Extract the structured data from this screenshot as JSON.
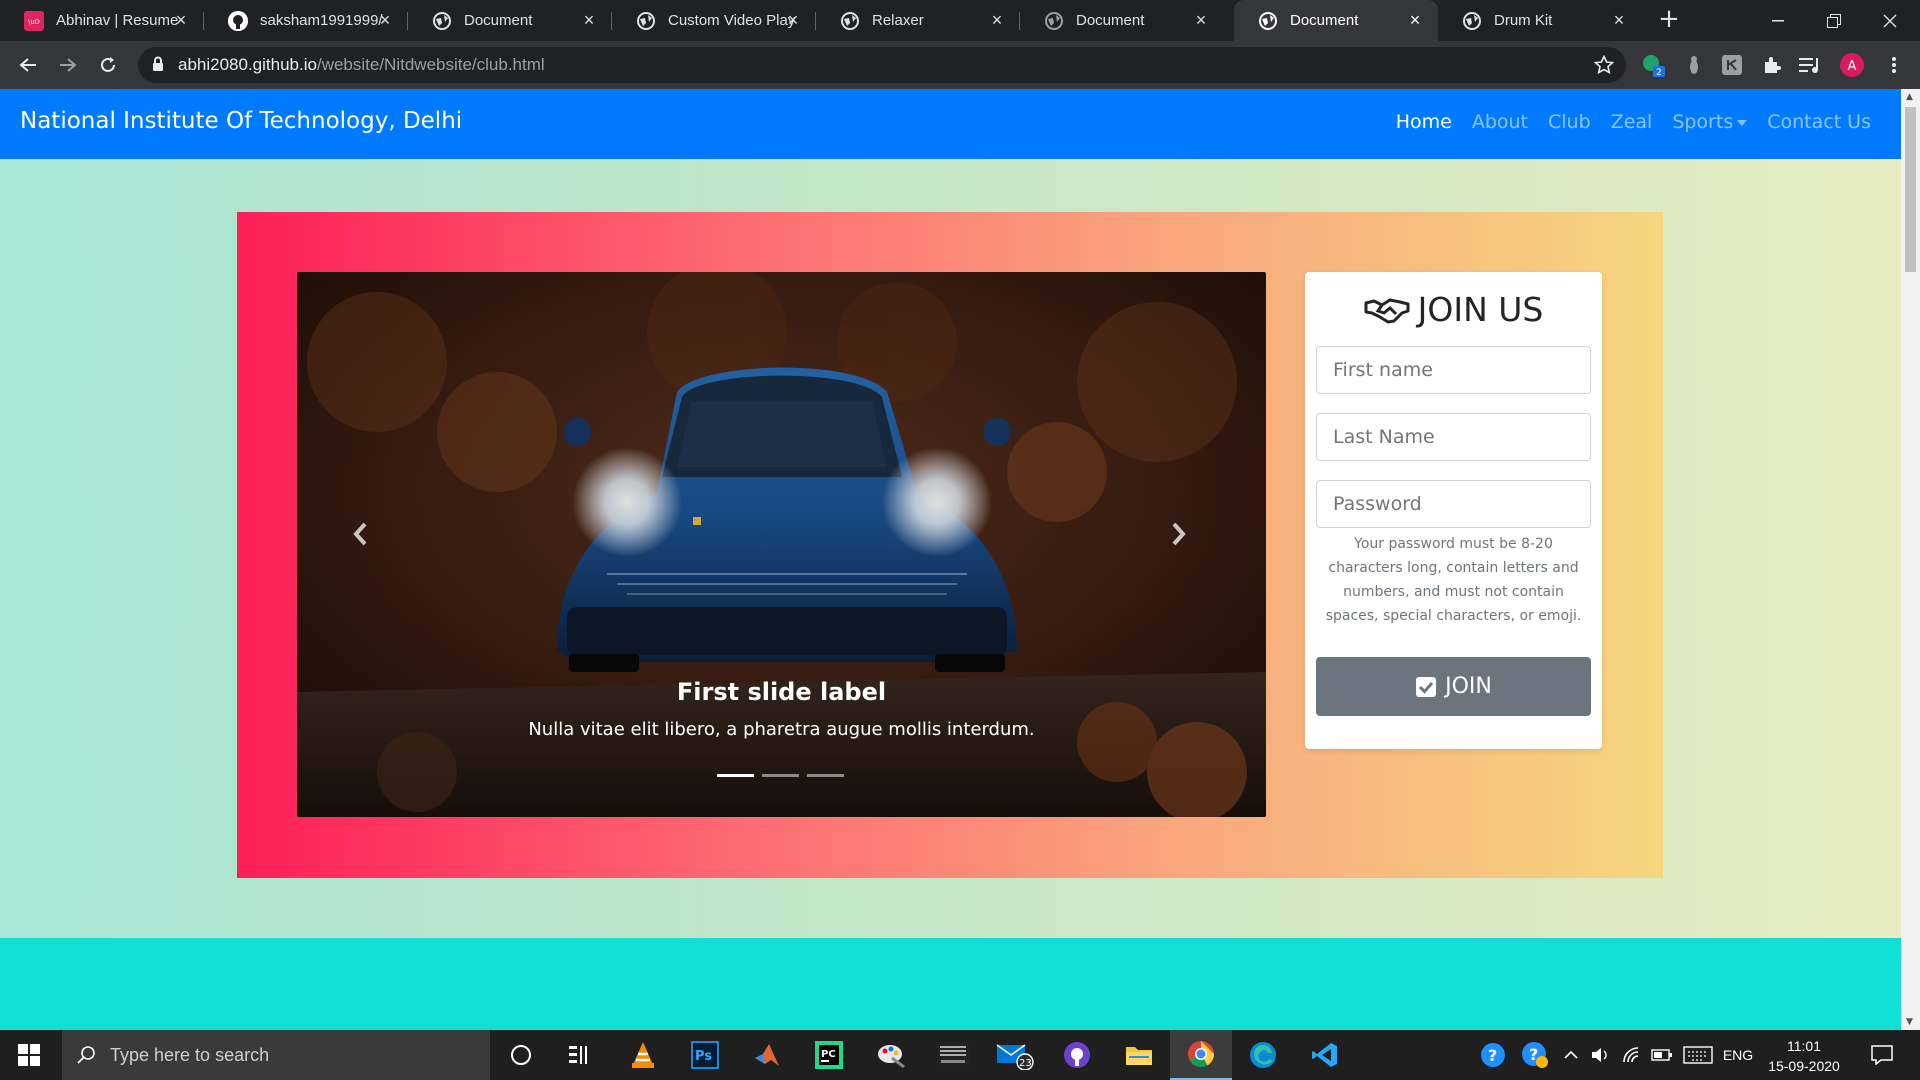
{
  "browser": {
    "tabs": [
      {
        "title": "Abhinav | Resume",
        "active": false
      },
      {
        "title": "saksham1991999/",
        "active": false
      },
      {
        "title": "Document",
        "active": false
      },
      {
        "title": "Custom Video Play",
        "active": false
      },
      {
        "title": "Relaxer",
        "active": false
      },
      {
        "title": "Document",
        "active": false
      },
      {
        "title": "Document",
        "active": true
      },
      {
        "title": "Drum Kit",
        "active": false
      }
    ],
    "url_host": "abhi2080.github.io",
    "url_path": "/website/Nitdwebsite/club.html",
    "extension_badge": "2",
    "profile_initial": "A"
  },
  "page": {
    "brand": "National Institute Of Technology, Delhi",
    "nav": [
      {
        "label": "Home",
        "active": true
      },
      {
        "label": "About",
        "active": false
      },
      {
        "label": "Club",
        "active": false
      },
      {
        "label": "Zeal",
        "active": false
      },
      {
        "label": "Sports",
        "active": false
      },
      {
        "label": "Contact Us",
        "active": false
      }
    ],
    "carousel": {
      "caption_title": "First slide label",
      "caption_text": "Nulla vitae elit libero, a pharetra augue mollis interdum.",
      "slide_count": 3,
      "active_slide": 1
    },
    "join": {
      "heading": "JOIN US",
      "first_name_placeholder": "First name",
      "last_name_placeholder": "Last Name",
      "password_placeholder": "Password",
      "password_hint": "Your password must be 8-20 characters long, contain letters and numbers, and must not contain spaces, special characters, or emoji.",
      "button_label": "JOIN"
    },
    "colors": {
      "navbar": "#007bff",
      "hero_gradient_start": "#fc1e57",
      "hero_gradient_end": "#f5d67f",
      "section2": "#11dfd3",
      "join_button": "#6c757d"
    }
  },
  "taskbar": {
    "search_placeholder": "Type here to search",
    "mail_badge": "23",
    "language": "ENG",
    "time": "11:01",
    "date": "15-09-2020"
  }
}
